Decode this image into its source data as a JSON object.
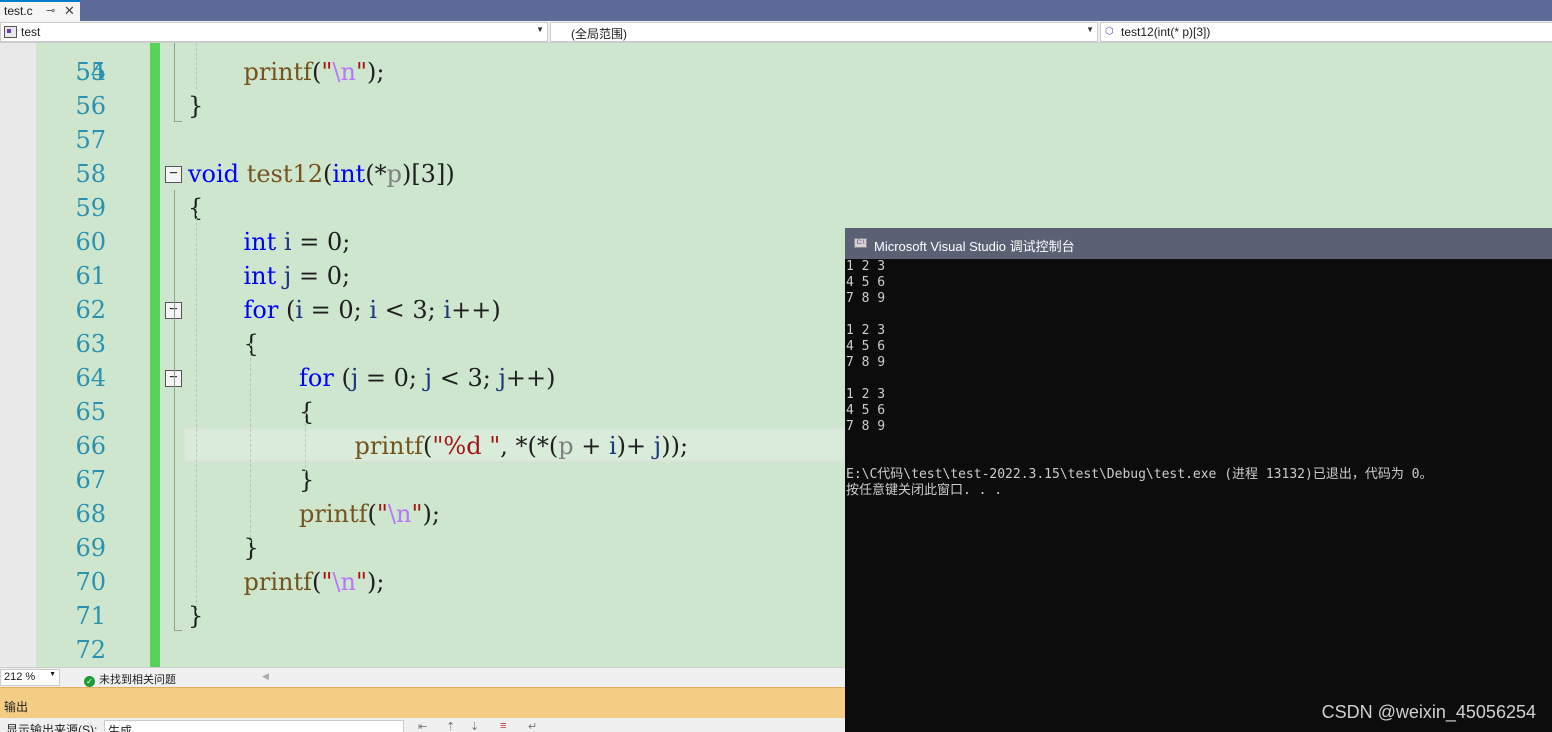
{
  "tab": {
    "title": "test.c",
    "pin_glyph": "⊸",
    "close_glyph": "✕"
  },
  "navbar": {
    "project": "test",
    "scope": "(全局范围)",
    "member": "test12(int(* p)[3])"
  },
  "editor": {
    "partial_top_line_number": "54",
    "lines": [
      {
        "number": "55",
        "segments": [
          [
            "fn",
            "printf"
          ],
          [
            "plain",
            "("
          ],
          [
            "str",
            "\""
          ],
          [
            "esc",
            "\\n"
          ],
          [
            "str",
            "\""
          ],
          [
            "plain",
            ");"
          ]
        ],
        "indent": 1
      },
      {
        "number": "56",
        "segments": [
          [
            "plain",
            "}"
          ]
        ],
        "indent": 0
      },
      {
        "number": "57",
        "segments": [],
        "indent": 0
      },
      {
        "number": "58",
        "segments": [
          [
            "kw",
            "void"
          ],
          [
            "plain",
            " "
          ],
          [
            "fn",
            "test12"
          ],
          [
            "plain",
            "("
          ],
          [
            "kw",
            "int"
          ],
          [
            "plain",
            "(*"
          ],
          [
            "param",
            "p"
          ],
          [
            "plain",
            ")[3])"
          ]
        ],
        "indent": 0,
        "fold": "−"
      },
      {
        "number": "59",
        "segments": [
          [
            "plain",
            "{"
          ]
        ],
        "indent": 0
      },
      {
        "number": "60",
        "segments": [
          [
            "kw",
            "int"
          ],
          [
            "plain",
            " "
          ],
          [
            "var",
            "i"
          ],
          [
            "plain",
            " = 0;"
          ]
        ],
        "indent": 1
      },
      {
        "number": "61",
        "segments": [
          [
            "kw",
            "int"
          ],
          [
            "plain",
            " "
          ],
          [
            "var",
            "j"
          ],
          [
            "plain",
            " = 0;"
          ]
        ],
        "indent": 1
      },
      {
        "number": "62",
        "segments": [
          [
            "kw",
            "for"
          ],
          [
            "plain",
            " ("
          ],
          [
            "var",
            "i"
          ],
          [
            "plain",
            " = 0; "
          ],
          [
            "var",
            "i"
          ],
          [
            "plain",
            " < 3; "
          ],
          [
            "var",
            "i"
          ],
          [
            "plain",
            "++)"
          ]
        ],
        "indent": 1,
        "fold": "−"
      },
      {
        "number": "63",
        "segments": [
          [
            "plain",
            "{"
          ]
        ],
        "indent": 1
      },
      {
        "number": "64",
        "segments": [
          [
            "kw",
            "for"
          ],
          [
            "plain",
            " ("
          ],
          [
            "var",
            "j"
          ],
          [
            "plain",
            " = 0; "
          ],
          [
            "var",
            "j"
          ],
          [
            "plain",
            " < 3; "
          ],
          [
            "var",
            "j"
          ],
          [
            "plain",
            "++)"
          ]
        ],
        "indent": 2,
        "fold": "−"
      },
      {
        "number": "65",
        "segments": [
          [
            "plain",
            "{"
          ]
        ],
        "indent": 2
      },
      {
        "number": "66",
        "segments": [
          [
            "fn",
            "printf"
          ],
          [
            "plain",
            "("
          ],
          [
            "str",
            "\"%d \""
          ],
          [
            "plain",
            ", *(*("
          ],
          [
            "param",
            "p"
          ],
          [
            "plain",
            " + "
          ],
          [
            "var",
            "i"
          ],
          [
            "plain",
            ")+ "
          ],
          [
            "var",
            "j"
          ],
          [
            "plain",
            "));"
          ]
        ],
        "indent": 3
      },
      {
        "number": "67",
        "segments": [
          [
            "plain",
            "}"
          ]
        ],
        "indent": 2
      },
      {
        "number": "68",
        "segments": [
          [
            "fn",
            "printf"
          ],
          [
            "plain",
            "("
          ],
          [
            "str",
            "\""
          ],
          [
            "esc",
            "\\n"
          ],
          [
            "str",
            "\""
          ],
          [
            "plain",
            ");"
          ]
        ],
        "indent": 2
      },
      {
        "number": "69",
        "segments": [
          [
            "plain",
            "}"
          ]
        ],
        "indent": 1
      },
      {
        "number": "70",
        "segments": [
          [
            "fn",
            "printf"
          ],
          [
            "plain",
            "("
          ],
          [
            "str",
            "\""
          ],
          [
            "esc",
            "\\n"
          ],
          [
            "str",
            "\""
          ],
          [
            "plain",
            ");"
          ]
        ],
        "indent": 1
      },
      {
        "number": "71",
        "segments": [
          [
            "plain",
            "}"
          ]
        ],
        "indent": 0
      },
      {
        "number": "72",
        "segments": [],
        "indent": 0
      }
    ]
  },
  "statusbar": {
    "zoom": "212 %",
    "issues": "未找到相关问题"
  },
  "output": {
    "title": "输出",
    "source_label": "显示输出来源(S):",
    "source_value": "生成"
  },
  "console": {
    "title": "Microsoft Visual Studio 调试控制台",
    "icon_text": "C:\\",
    "text": "1 2 3\n4 5 6\n7 8 9\n\n1 2 3\n4 5 6\n7 8 9\n\n1 2 3\n4 5 6\n7 8 9\n\n\nE:\\C代码\\test\\test-2022.3.15\\test\\Debug\\test.exe (进程 13132)已退出，代码为 0。\n按任意键关闭此窗口. . .",
    "watermark": "CSDN @weixin_45056254"
  },
  "colors": {
    "editor_background": "#cde6cd",
    "line_number": "#2b91af",
    "keyword": "#0000ff",
    "function": "#74531f",
    "string": "#a31515",
    "escape": "#b776fb",
    "change_bar": "#57d457",
    "output_header": "#f5cc84",
    "console_background": "#0c0c0c"
  }
}
